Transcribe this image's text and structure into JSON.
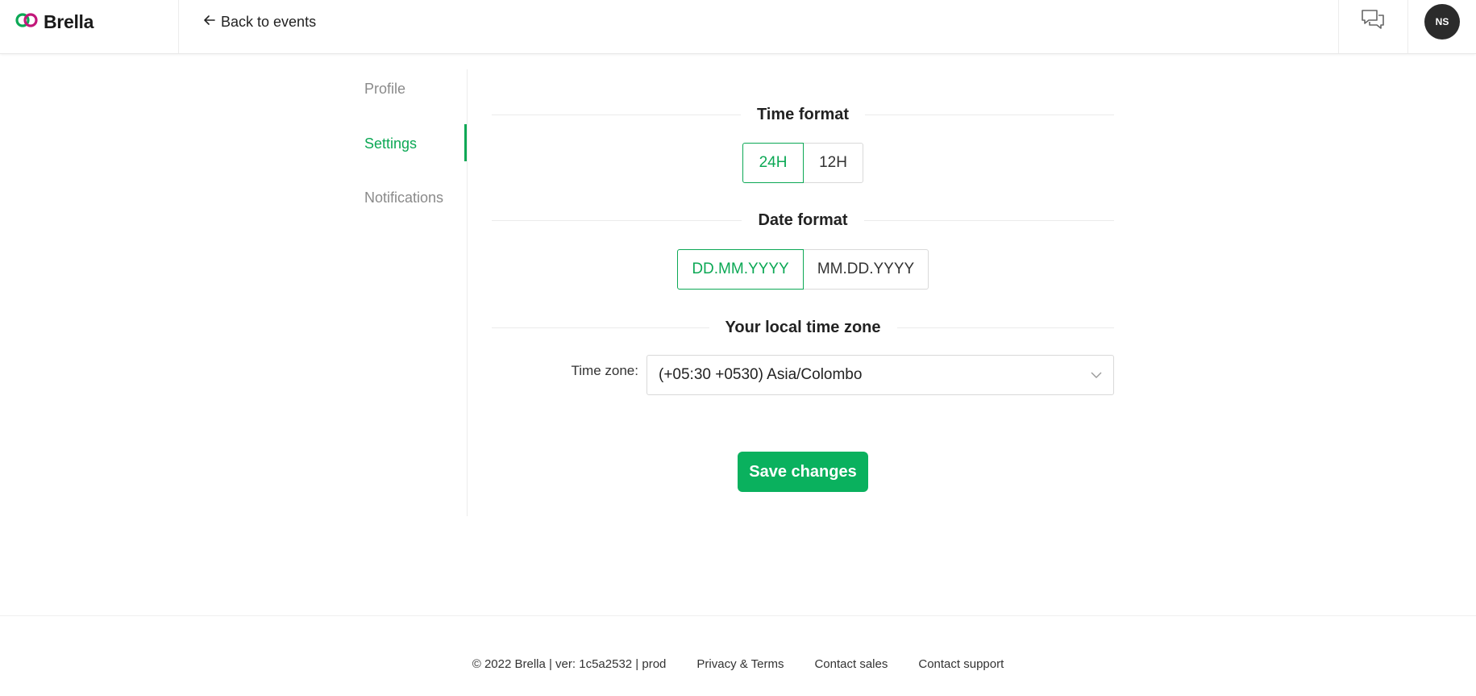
{
  "header": {
    "logo_text": "Brella",
    "back_label": "Back to events",
    "avatar_initials": "NS"
  },
  "sidebar": {
    "items": [
      {
        "label": "Profile",
        "active": false
      },
      {
        "label": "Settings",
        "active": true
      },
      {
        "label": "Notifications",
        "active": false
      }
    ]
  },
  "settings": {
    "time_format": {
      "title": "Time format",
      "options": [
        "24H",
        "12H"
      ],
      "selected": "24H"
    },
    "date_format": {
      "title": "Date format",
      "options": [
        "DD.MM.YYYY",
        "MM.DD.YYYY"
      ],
      "selected": "DD.MM.YYYY"
    },
    "time_zone": {
      "title": "Your local time zone",
      "label": "Time zone",
      "value": "(+05:30 +0530) Asia/Colombo"
    },
    "save_label": "Save changes"
  },
  "footer": {
    "copyright": "© 2022 Brella | ver: 1c5a2532 | prod",
    "links": [
      "Privacy & Terms",
      "Contact sales",
      "Contact support"
    ]
  },
  "colors": {
    "accent": "#0ca855",
    "save_button": "#0ab15e",
    "avatar_bg": "#2b2b2b"
  },
  "icons": [
    "brella-logo-icon",
    "arrow-left-icon",
    "chat-icon",
    "chevron-down-icon"
  ]
}
